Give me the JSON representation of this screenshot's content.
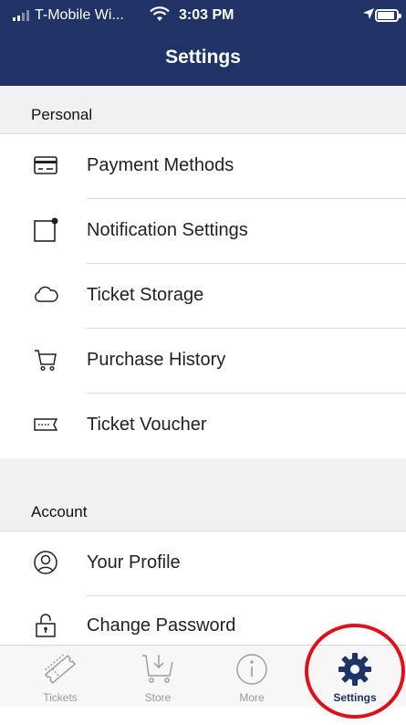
{
  "status_bar": {
    "carrier": "T-Mobile Wi...",
    "time": "3:03 PM"
  },
  "nav": {
    "title": "Settings"
  },
  "sections": {
    "personal": {
      "header": "Personal",
      "items": [
        {
          "label": "Payment Methods",
          "icon": "credit-card-icon"
        },
        {
          "label": "Notification Settings",
          "icon": "notification-icon"
        },
        {
          "label": "Ticket Storage",
          "icon": "cloud-icon"
        },
        {
          "label": "Purchase History",
          "icon": "shopping-cart-icon"
        },
        {
          "label": "Ticket Voucher",
          "icon": "voucher-icon"
        }
      ]
    },
    "account": {
      "header": "Account",
      "items": [
        {
          "label": "Your Profile",
          "icon": "profile-icon"
        },
        {
          "label": "Change Password",
          "icon": "unlock-icon"
        }
      ]
    }
  },
  "tabs": [
    {
      "label": "Tickets",
      "icon": "tickets-icon",
      "active": false
    },
    {
      "label": "Store",
      "icon": "store-cart-icon",
      "active": false
    },
    {
      "label": "More",
      "icon": "info-icon",
      "active": false
    },
    {
      "label": "Settings",
      "icon": "gear-icon",
      "active": true
    }
  ],
  "colors": {
    "nav_background": "#1f3366",
    "section_background": "#f1f1f4",
    "active_tab": "#1f3366",
    "highlight_ring": "#e0101a"
  }
}
